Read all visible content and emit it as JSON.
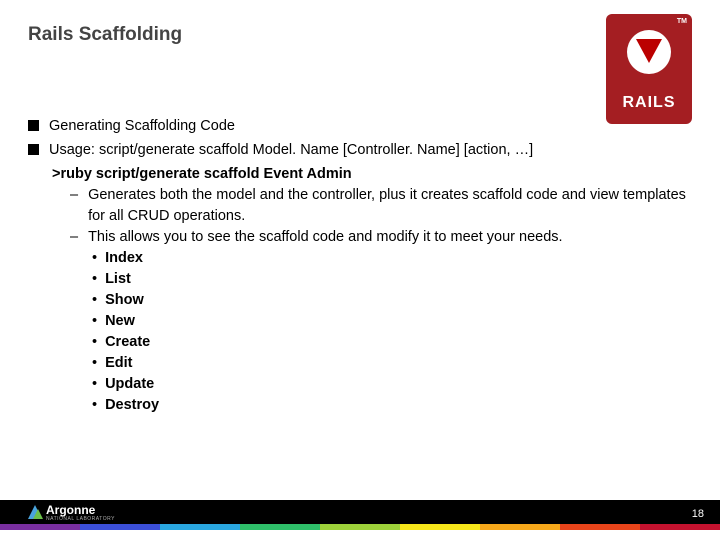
{
  "title": "Rails Scaffolding",
  "logo": {
    "text": "RAILS",
    "tm": "TM"
  },
  "bullets": {
    "b1": "Generating Scaffolding Code",
    "b2": "Usage: script/generate scaffold Model. Name [Controller. Name] [action, …]"
  },
  "cmd": ">ruby script/generate scaffold Event Admin",
  "sub": {
    "s1": "Generates both the model and the controller, plus it creates scaffold code and view templates for all CRUD operations.",
    "s2": "This allows you to see the scaffold code and modify it to meet your needs."
  },
  "ops": {
    "o1": "Index",
    "o2": "List",
    "o3": "Show",
    "o4": "New",
    "o5": "Create",
    "o6": "Edit",
    "o7": "Update",
    "o8": "Destroy"
  },
  "footer": {
    "brand": "Argonne",
    "sub": "NATIONAL LABORATORY",
    "page": "18"
  }
}
